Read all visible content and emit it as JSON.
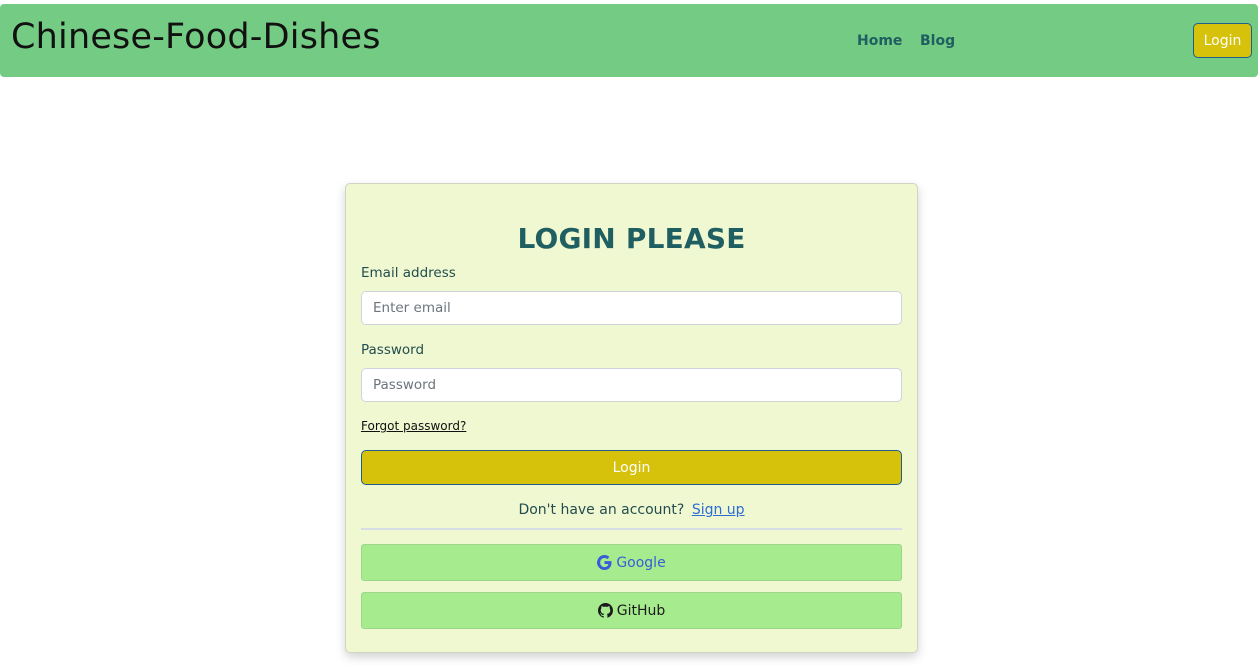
{
  "navbar": {
    "brand": "Chinese-Food-Dishes",
    "links": [
      {
        "label": "Home"
      },
      {
        "label": "Blog"
      }
    ],
    "login_button": "Login"
  },
  "login_form": {
    "title": "LOGIN PLEASE",
    "email_label": "Email address",
    "email_placeholder": "Enter email",
    "email_value": "",
    "password_label": "Password",
    "password_placeholder": "Password",
    "password_value": "",
    "forgot_password": "Forgot password?",
    "submit_label": "Login",
    "signup_prompt": "Don't have an account?",
    "signup_link": "Sign up",
    "social": {
      "google": {
        "label": "Google",
        "icon": "google-icon"
      },
      "github": {
        "label": "GitHub",
        "icon": "github-icon"
      }
    }
  },
  "colors": {
    "navbar_bg": "#74cc84",
    "accent_yellow": "#d6c20a",
    "card_bg": "#f0f8d2",
    "title_teal": "#1f5e61",
    "social_green": "#a6ec8f",
    "link_blue": "#2c6cd6"
  }
}
